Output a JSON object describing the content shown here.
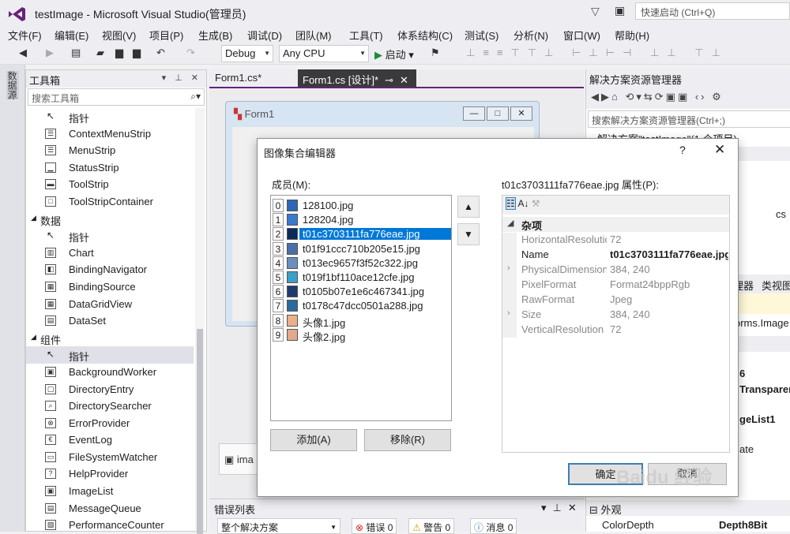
{
  "window": {
    "title": "testImage - Microsoft Visual Studio(管理员)",
    "quick_launch": "快速启动 (Ctrl+Q)"
  },
  "menu": [
    "文件(F)",
    "编辑(E)",
    "视图(V)",
    "项目(P)",
    "生成(B)",
    "调试(D)",
    "团队(M)",
    "工具(T)",
    "体系结构(C)",
    "测试(S)",
    "分析(N)",
    "窗口(W)",
    "帮助(H)"
  ],
  "toolbar": {
    "config": "Debug",
    "platform": "Any CPU",
    "run": "启动"
  },
  "left_strip": "数据源",
  "toolbox": {
    "title": "工具箱",
    "search_placeholder": "搜索工具箱",
    "items": [
      {
        "kind": "item",
        "label": "指针",
        "icon": "pointer-icon"
      },
      {
        "kind": "item",
        "label": "ContextMenuStrip",
        "icon": "context-menu-icon"
      },
      {
        "kind": "item",
        "label": "MenuStrip",
        "icon": "menu-strip-icon"
      },
      {
        "kind": "item",
        "label": "StatusStrip",
        "icon": "status-strip-icon"
      },
      {
        "kind": "item",
        "label": "ToolStrip",
        "icon": "tool-strip-icon"
      },
      {
        "kind": "item",
        "label": "ToolStripContainer",
        "icon": "tool-strip-container-icon"
      },
      {
        "kind": "cat",
        "label": "数据"
      },
      {
        "kind": "item",
        "label": "指针",
        "icon": "pointer-icon"
      },
      {
        "kind": "item",
        "label": "Chart",
        "icon": "chart-icon"
      },
      {
        "kind": "item",
        "label": "BindingNavigator",
        "icon": "binding-navigator-icon"
      },
      {
        "kind": "item",
        "label": "BindingSource",
        "icon": "binding-source-icon"
      },
      {
        "kind": "item",
        "label": "DataGridView",
        "icon": "data-grid-view-icon"
      },
      {
        "kind": "item",
        "label": "DataSet",
        "icon": "dataset-icon"
      },
      {
        "kind": "cat",
        "label": "组件"
      },
      {
        "kind": "item",
        "label": "指针",
        "icon": "pointer-icon",
        "selected": true
      },
      {
        "kind": "item",
        "label": "BackgroundWorker",
        "icon": "background-worker-icon"
      },
      {
        "kind": "item",
        "label": "DirectoryEntry",
        "icon": "directory-entry-icon"
      },
      {
        "kind": "item",
        "label": "DirectorySearcher",
        "icon": "directory-searcher-icon"
      },
      {
        "kind": "item",
        "label": "ErrorProvider",
        "icon": "error-provider-icon"
      },
      {
        "kind": "item",
        "label": "EventLog",
        "icon": "event-log-icon"
      },
      {
        "kind": "item",
        "label": "FileSystemWatcher",
        "icon": "file-system-watcher-icon"
      },
      {
        "kind": "item",
        "label": "HelpProvider",
        "icon": "help-provider-icon"
      },
      {
        "kind": "item",
        "label": "ImageList",
        "icon": "image-list-icon"
      },
      {
        "kind": "item",
        "label": "MessageQueue",
        "icon": "message-queue-icon"
      },
      {
        "kind": "item",
        "label": "PerformanceCounter",
        "icon": "performance-counter-icon"
      }
    ]
  },
  "editor": {
    "tabs": [
      "Form1.cs*",
      "Form1.cs [设计]*"
    ],
    "form_title": "Form1",
    "tray_item": "ima"
  },
  "errors": {
    "title": "错误列表",
    "scope": "整个解决方案",
    "errors": "错误 0",
    "warnings": "警告 0",
    "messages": "消息 0"
  },
  "solution_explorer": {
    "title": "解决方案资源管理器",
    "search": "搜索解决方案资源管理器(Ctrl+;)",
    "root": "解决方案\"testImage\"(1 个项目)"
  },
  "right_panel": {
    "t1": "cs",
    "t2": "理器",
    "t3": "类视图",
    "t4": "orms.Image",
    "t5": "6",
    "t6": "Transparer",
    "t7": "geList1",
    "t8": "ate",
    "t9": "外观",
    "t10": "ColorDepth",
    "t11": "Depth8Bit"
  },
  "dialog": {
    "title": "图像集合编辑器",
    "help": "?",
    "members_label": "成员(M):",
    "members": [
      "128100.jpg",
      "128204.jpg",
      "t01c3703111fa776eae.jpg",
      "t01f91ccc710b205e15.jpg",
      "t013ec9657f3f52c322.jpg",
      "t019f1bf110ace12cfe.jpg",
      "t0105b07e1e6c467341.jpg",
      "t0178c47dcc0501a288.jpg",
      "头像1.jpg",
      "头像2.jpg"
    ],
    "selected_index": 2,
    "add": "添加(A)",
    "remove": "移除(R)",
    "props_label": "t01c3703111fa776eae.jpg 属性(P):",
    "category": "杂项",
    "props": [
      {
        "name": "HorizontalResolution",
        "value": "72",
        "dark": false,
        "expand": false
      },
      {
        "name": "Name",
        "value": "t01c3703111fa776eae.jpg",
        "dark": true,
        "expand": false
      },
      {
        "name": "PhysicalDimension",
        "value": "384, 240",
        "dark": false,
        "expand": true
      },
      {
        "name": "PixelFormat",
        "value": "Format24bppRgb",
        "dark": false,
        "expand": false
      },
      {
        "name": "RawFormat",
        "value": "Jpeg",
        "dark": false,
        "expand": false
      },
      {
        "name": "Size",
        "value": "384, 240",
        "dark": false,
        "expand": true
      },
      {
        "name": "VerticalResolution",
        "value": "72",
        "dark": false,
        "expand": false
      }
    ],
    "ok": "确定",
    "cancel": "取消"
  },
  "watermark": "Baidu 经验"
}
